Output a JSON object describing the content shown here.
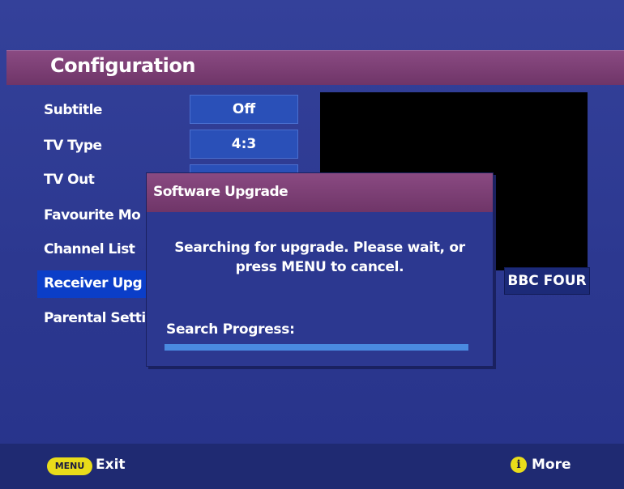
{
  "header": {
    "title": "Configuration"
  },
  "menu": {
    "items": [
      {
        "label": "Subtitle"
      },
      {
        "label": "TV Type"
      },
      {
        "label": "TV Out"
      },
      {
        "label": "Favourite Mo"
      },
      {
        "label": "Channel List"
      },
      {
        "label": "Receiver Upg"
      },
      {
        "label": "Parental Setti"
      }
    ],
    "selected_index": 5
  },
  "values": {
    "subtitle": "Off",
    "tv_type": "4:3",
    "tv_out": ""
  },
  "preview": {
    "channel_name": "BBC FOUR"
  },
  "dialog": {
    "title": "Software Upgrade",
    "message_line1": "Searching for upgrade. Please wait, or",
    "message_line2": "press MENU to cancel.",
    "progress_label": "Search Progress:",
    "progress_fraction": 1.0
  },
  "footer": {
    "menu_key": "MENU",
    "exit_label": "Exit",
    "info_icon": "i",
    "more_label": "More"
  },
  "colors": {
    "background": "#2c3890",
    "title_bar": "#7a3d72",
    "highlight": "#0b3ec8",
    "key_yellow": "#e9dc1a"
  }
}
